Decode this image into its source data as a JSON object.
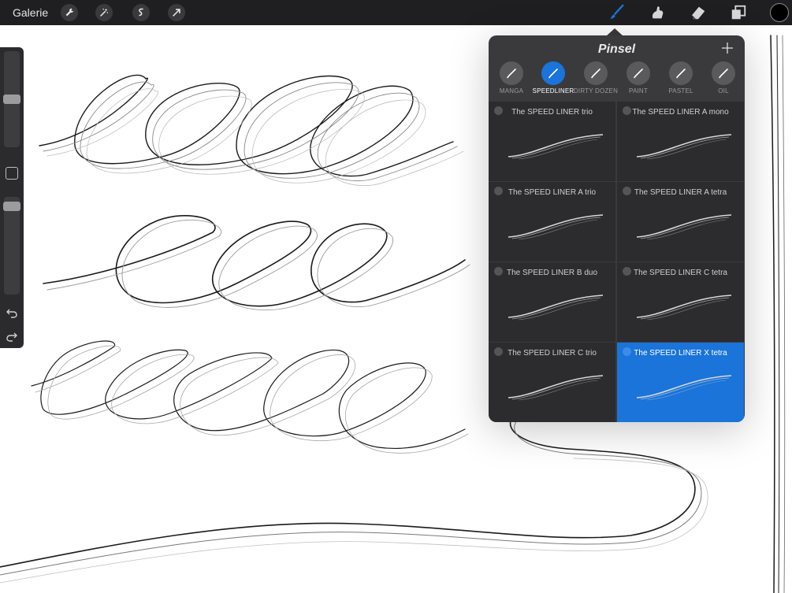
{
  "toolbar": {
    "gallery_label": "Galerie",
    "left_tools": [
      "wrench-icon",
      "magic-wand-icon",
      "selection-icon",
      "transform-arrow-icon"
    ],
    "right_tools": [
      "brush-icon",
      "smudge-icon",
      "eraser-icon",
      "layers-icon"
    ],
    "active_tool": "brush-icon",
    "current_color": "#000000",
    "accent_color": "#1a74d9"
  },
  "brush_panel": {
    "title": "Pinsel",
    "sets": [
      {
        "label": "MANGA",
        "active": false
      },
      {
        "label": "SPEEDLINER",
        "active": true
      },
      {
        "label": "DIRTY DOZEN",
        "active": false
      },
      {
        "label": "PAINT",
        "active": false
      },
      {
        "label": "PASTEL",
        "active": false
      },
      {
        "label": "OIL",
        "active": false
      }
    ],
    "brushes": [
      {
        "name": "The SPEED LINER trio",
        "selected": false
      },
      {
        "name": "The SPEED LINER A mono",
        "selected": false
      },
      {
        "name": "The SPEED LINER A trio",
        "selected": false
      },
      {
        "name": "The SPEED LINER A tetra",
        "selected": false
      },
      {
        "name": "The SPEED LINER B duo",
        "selected": false
      },
      {
        "name": "The SPEED LINER C tetra",
        "selected": false
      },
      {
        "name": "The SPEED LINER C trio",
        "selected": false
      },
      {
        "name": "The SPEED LINER X tetra",
        "selected": true
      }
    ]
  },
  "sidebar": {
    "brush_size_level": 0.5,
    "opacity_level": 0.95,
    "icons": [
      "modify-square-icon",
      "undo-icon",
      "redo-icon"
    ]
  }
}
